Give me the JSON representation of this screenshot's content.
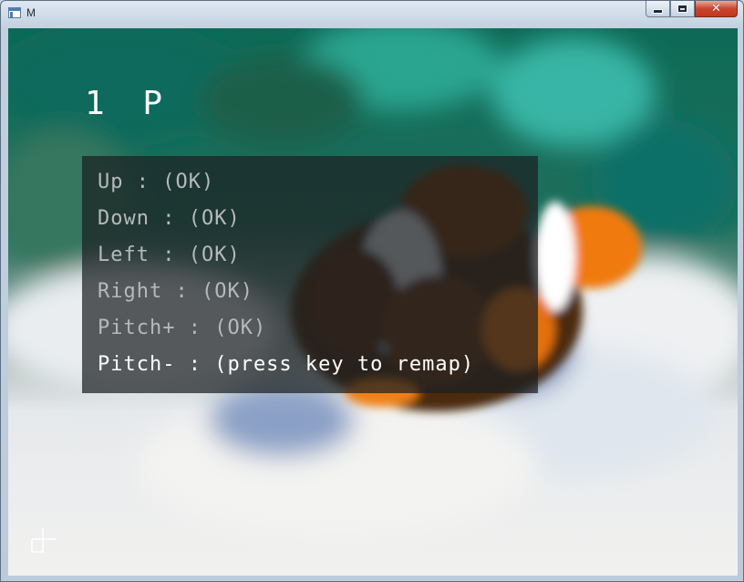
{
  "window": {
    "title": "M",
    "buttons": {
      "minimize": "minimize",
      "maximize": "maximize",
      "close": "close"
    }
  },
  "game": {
    "player_label": "1 P",
    "menu": {
      "items": [
        {
          "label": "Up : (OK)",
          "state": "done"
        },
        {
          "label": "Down : (OK)",
          "state": "done"
        },
        {
          "label": "Left : (OK)",
          "state": "done"
        },
        {
          "label": "Right : (OK)",
          "state": "done"
        },
        {
          "label": "Pitch+ : (OK)",
          "state": "done"
        },
        {
          "label": "Pitch- : (press key to remap)",
          "state": "active"
        }
      ]
    }
  },
  "colors": {
    "menu_text": "#b6b9bb",
    "menu_text_active": "#ffffff",
    "close_button": "#c9452d"
  }
}
